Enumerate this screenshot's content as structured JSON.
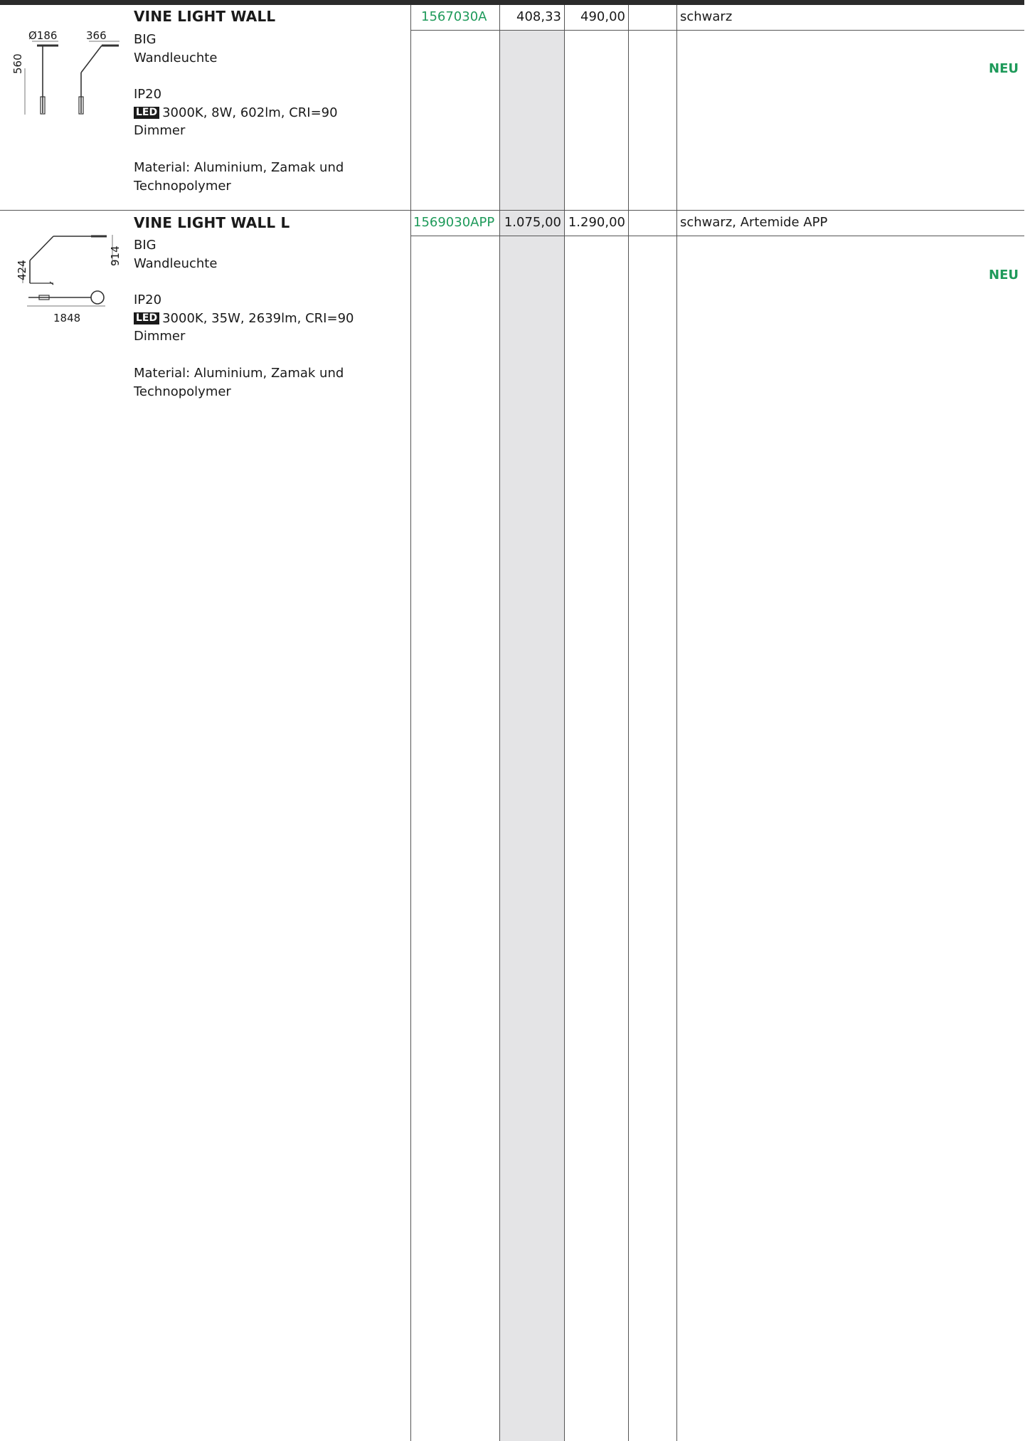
{
  "colors": {
    "code_green": "#1e9a5a",
    "shade": "#e4e4e6",
    "top_bar": "#2b2b2b"
  },
  "products": [
    {
      "title": "VINE LIGHT WALL",
      "size": "BIG",
      "type": "Wandleuchte",
      "ip": "IP20",
      "led_badge": "LED",
      "led_spec": "3000K, 8W, 602lm, CRI=90",
      "dimmer": "Dimmer",
      "material_1": "Material: Aluminium, Zamak und",
      "material_2": "Technopolymer",
      "code": "1567030A",
      "price_net": "408,33",
      "price_gross": "490,00",
      "extra": "",
      "finish": "schwarz",
      "badge": "NEU",
      "dims": {
        "diameter": "Ø186",
        "width": "366",
        "height": "560"
      }
    },
    {
      "title": "VINE LIGHT WALL L",
      "size": "BIG",
      "type": "Wandleuchte",
      "ip": "IP20",
      "led_badge": "LED",
      "led_spec": "3000K, 35W, 2639lm, CRI=90",
      "dimmer": "Dimmer",
      "material_1": "Material: Aluminium, Zamak und",
      "material_2": "Technopolymer",
      "code": "1569030APP",
      "price_net": "1.075,00",
      "price_gross": "1.290,00",
      "extra": "",
      "finish": "schwarz, Artemide APP",
      "badge": "NEU",
      "dims": {
        "height_right": "914",
        "height_left": "424",
        "length": "1848"
      }
    }
  ]
}
